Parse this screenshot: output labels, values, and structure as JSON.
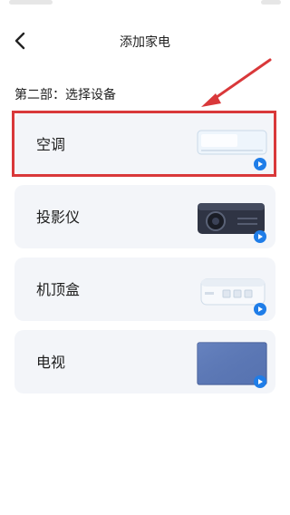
{
  "header": {
    "title": "添加家电",
    "back_icon": "chevron-left-icon"
  },
  "step_label": "第二部：选择设备",
  "devices": [
    {
      "label": "空调",
      "icon": "air-conditioner-icon"
    },
    {
      "label": "投影仪",
      "icon": "projector-icon"
    },
    {
      "label": "机顶盒",
      "icon": "set-top-box-icon"
    },
    {
      "label": "电视",
      "icon": "tv-icon"
    }
  ],
  "annotation": {
    "color": "#d9383a",
    "target": "空调"
  },
  "colors": {
    "card_bg": "#f3f5f9",
    "accent": "#1f7de8"
  }
}
